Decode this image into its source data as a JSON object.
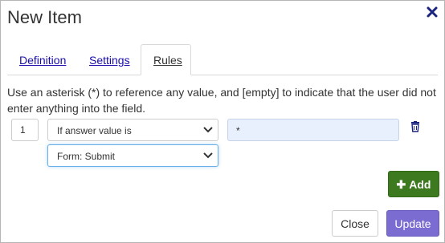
{
  "dialog": {
    "title": "New Item",
    "close_icon": "close-icon"
  },
  "tabs": [
    {
      "label": "Definition",
      "active": false
    },
    {
      "label": "Settings",
      "active": false
    },
    {
      "label": "Rules",
      "active": true
    }
  ],
  "rules": {
    "description": "Use an asterisk (*) to reference any value, and [empty] to indicate that the user did not enter anything into the field.",
    "rows": [
      {
        "order": "1",
        "condition": "If answer value is",
        "value": "*",
        "action": "Form: Submit",
        "delete_icon": "trash-icon"
      }
    ],
    "add_label": "Add",
    "add_icon": "plus-icon"
  },
  "footer": {
    "close_label": "Close",
    "update_label": "Update"
  },
  "colors": {
    "add_button": "#3d7a1f",
    "update_button": "#7b6cd1",
    "link": "#1a0dab",
    "input_bg": "#e8f0fe",
    "close_x": "#1a237e",
    "trash": "#1a237e"
  }
}
